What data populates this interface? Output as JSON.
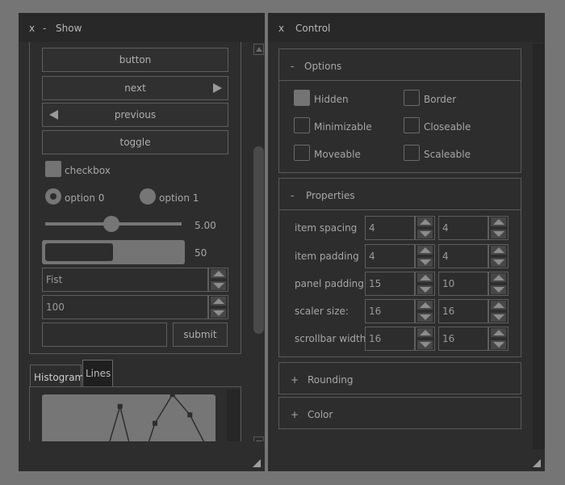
{
  "show_window": {
    "close": "x",
    "minimize": "-",
    "title": "Show",
    "buttons": {
      "button": "button",
      "next": "next",
      "previous": "previous",
      "toggle": "toggle"
    },
    "checkbox_label": "checkbox",
    "options": [
      "option 0",
      "option 1"
    ],
    "slider": {
      "value_text": "5.00",
      "fraction": 0.37
    },
    "progress": {
      "value_text": "50",
      "fraction": 0.5
    },
    "combo1": {
      "value": "Fist"
    },
    "combo2": {
      "value": "100"
    },
    "text_input": {
      "value": ""
    },
    "submit": "submit",
    "tabs": [
      "Histogram",
      "Lines"
    ],
    "active_tab": "Lines"
  },
  "control_window": {
    "close": "x",
    "title": "Control",
    "options_section": {
      "toggle": "-",
      "title": "Options",
      "flags": [
        {
          "label": "Hidden",
          "checked": true
        },
        {
          "label": "Border",
          "checked": false
        },
        {
          "label": "Minimizable",
          "checked": false
        },
        {
          "label": "Closeable",
          "checked": false
        },
        {
          "label": "Moveable",
          "checked": false
        },
        {
          "label": "Scaleable",
          "checked": false
        }
      ]
    },
    "properties_section": {
      "toggle": "-",
      "title": "Properties",
      "rows": [
        {
          "label": "item spacing",
          "a": "4",
          "b": "4"
        },
        {
          "label": "item padding",
          "a": "4",
          "b": "4"
        },
        {
          "label": "panel padding",
          "a": "15",
          "b": "10"
        },
        {
          "label": "scaler size:",
          "a": "16",
          "b": "16"
        },
        {
          "label": "scrollbar width:",
          "a": "16",
          "b": "16"
        }
      ]
    },
    "rounding_section": {
      "toggle": "+",
      "title": "Rounding"
    },
    "color_section": {
      "toggle": "+",
      "title": "Color"
    }
  },
  "colors": {
    "background": "#757575",
    "window": "#2d2d2d",
    "border": "#5a5a5a",
    "accent": "#747474"
  },
  "chart_data": {
    "type": "line",
    "x": [
      0,
      1,
      2,
      3,
      4,
      5,
      6,
      7,
      8,
      9
    ],
    "values": [
      0.02,
      0.1,
      0.3,
      0.18,
      0.53,
      0.12,
      0.43,
      0.6,
      0.48,
      0.28
    ]
  }
}
